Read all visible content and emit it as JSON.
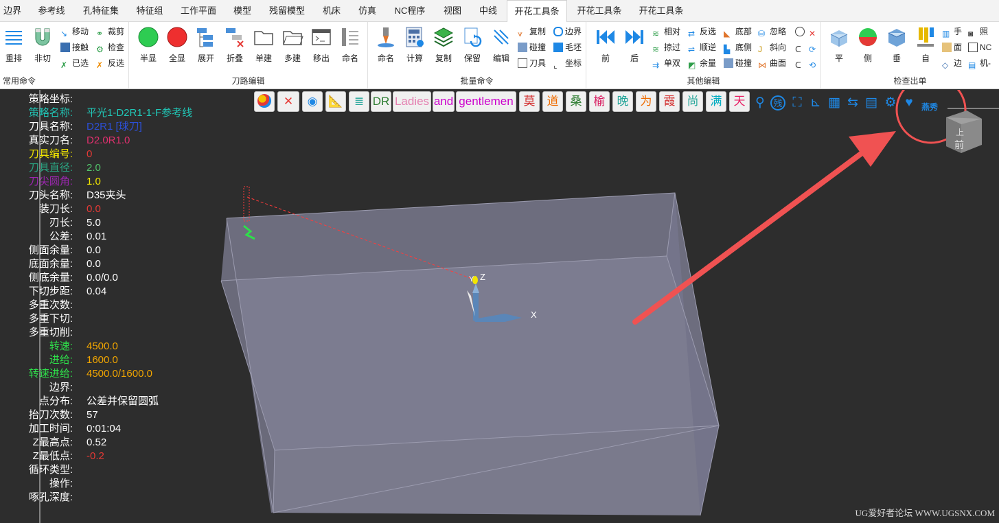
{
  "tabs": [
    {
      "label": "边界"
    },
    {
      "label": "参考线"
    },
    {
      "label": "孔特征集"
    },
    {
      "label": "特征组"
    },
    {
      "label": "工作平面"
    },
    {
      "label": "模型"
    },
    {
      "label": "残留模型"
    },
    {
      "label": "机床"
    },
    {
      "label": "仿真"
    },
    {
      "label": "NC程序"
    },
    {
      "label": "视图"
    },
    {
      "label": "中线"
    },
    {
      "label": "开花工具条"
    },
    {
      "label": "开花工具条"
    },
    {
      "label": "开花工具条"
    }
  ],
  "active_tab_index": 12,
  "groups": {
    "common": {
      "label": "常用命令",
      "big": [
        "重排",
        "非切"
      ],
      "small": [
        "移动",
        "接触",
        "已选",
        "裁剪",
        "检查",
        "反选"
      ]
    },
    "path_edit": {
      "label": "刀路编辑",
      "big": [
        "半显",
        "全显",
        "展开",
        "折叠",
        "单建",
        "多建",
        "移出",
        "命名"
      ]
    },
    "batch": {
      "label": "批量命令",
      "big": [
        "命名",
        "计算",
        "复制",
        "保留",
        "编辑"
      ],
      "small": [
        "复制",
        "碰撞",
        "刀具",
        "边界",
        "毛坯",
        "坐标"
      ]
    },
    "other_edit": {
      "label": "其他编辑",
      "big": [
        "前",
        "后"
      ],
      "small": [
        "相对",
        "掠过",
        "单双",
        "反选",
        "顺逆",
        "余量",
        "底部",
        "底侧",
        "碰撞",
        "忽略",
        "斜向",
        "曲面"
      ]
    },
    "check": {
      "label": "检查出单",
      "big": [
        "平",
        "侧",
        "垂",
        "自"
      ],
      "small": [
        "手",
        "面",
        "边",
        "照",
        "NC",
        "机-"
      ]
    }
  },
  "float_toolbar": {
    "text_buttons": [
      {
        "label": "DR",
        "color": "#2e7d32"
      },
      {
        "label": "Ladies",
        "color": "#e57fb0"
      },
      {
        "label": "and",
        "color": "#cc00cc"
      },
      {
        "label": "gentlemen",
        "color": "#cc00cc"
      },
      {
        "label": "莫",
        "color": "#d32f2f"
      },
      {
        "label": "道",
        "color": "#ef6c00"
      },
      {
        "label": "桑",
        "color": "#2e7d32"
      },
      {
        "label": "榆",
        "color": "#d81b60"
      },
      {
        "label": "晚",
        "color": "#26a69a"
      },
      {
        "label": "为",
        "color": "#ef6c00"
      },
      {
        "label": "霞",
        "color": "#d32f2f"
      },
      {
        "label": "尚",
        "color": "#26a69a"
      },
      {
        "label": "满",
        "color": "#00acc1"
      },
      {
        "label": "天",
        "color": "#e91e63"
      }
    ],
    "end_label": "燕秀",
    "residual_label": "残"
  },
  "info": [
    {
      "label": "策略坐标:",
      "value": "",
      "lc": "#ffffff",
      "vc": "#ffffff"
    },
    {
      "label": "策略名称:",
      "value": "平光1-D2R1-1-F参考线",
      "lc": "#21c6b6",
      "vc": "#21c6b6"
    },
    {
      "label": "刀具名称:",
      "value": "D2R1 [球刀]",
      "lc": "#ffffff",
      "vc": "#2c4fd6"
    },
    {
      "label": "真实刀名:",
      "value": "D2.0R1.0",
      "lc": "#ffffff",
      "vc": "#e0306e"
    },
    {
      "label": "刀具编号:",
      "value": "0",
      "lc": "#f2e600",
      "vc": "#e53935"
    },
    {
      "label": "刀具直径:",
      "value": "2.0",
      "lc": "#2aa784",
      "vc": "#52c36a"
    },
    {
      "label": "刀尖圆角:",
      "value": "1.0",
      "lc": "#9c27b0",
      "vc": "#f2e600"
    },
    {
      "label": "刀头名称:",
      "value": "D35夹头",
      "lc": "#ffffff",
      "vc": "#ffffff"
    },
    {
      "label": "装刀长:",
      "value": "0.0",
      "lc": "#ffffff",
      "vc": "#e53935"
    },
    {
      "label": "刃长:",
      "value": "5.0",
      "lc": "#ffffff",
      "vc": "#ffffff"
    },
    {
      "label": "公差:",
      "value": "0.01",
      "lc": "#ffffff",
      "vc": "#ffffff"
    },
    {
      "label": "侧面余量:",
      "value": "0.0",
      "lc": "#ffffff",
      "vc": "#ffffff"
    },
    {
      "label": "底面余量:",
      "value": "0.0",
      "lc": "#ffffff",
      "vc": "#ffffff"
    },
    {
      "label": "侧底余量:",
      "value": "0.0/0.0",
      "lc": "#ffffff",
      "vc": "#ffffff"
    },
    {
      "label": "下切步距:",
      "value": "0.04",
      "lc": "#ffffff",
      "vc": "#ffffff"
    },
    {
      "label": "多重次数:",
      "value": "",
      "lc": "#ffffff",
      "vc": "#ffffff"
    },
    {
      "label": "多重下切:",
      "value": "",
      "lc": "#ffffff",
      "vc": "#ffffff"
    },
    {
      "label": "多重切削:",
      "value": "",
      "lc": "#ffffff",
      "vc": "#ffffff"
    },
    {
      "label": "转速:",
      "value": "4500.0",
      "lc": "#2ee04a",
      "vc": "#f2a600"
    },
    {
      "label": "进给:",
      "value": "1600.0",
      "lc": "#2ee04a",
      "vc": "#f2a600"
    },
    {
      "label": "转速进给:",
      "value": "4500.0/1600.0",
      "lc": "#2ee04a",
      "vc": "#f2a600"
    },
    {
      "label": "边界:",
      "value": "",
      "lc": "#ffffff",
      "vc": "#ffffff"
    },
    {
      "label": "点分布:",
      "value": "公差并保留圆弧",
      "lc": "#ffffff",
      "vc": "#ffffff"
    },
    {
      "label": "抬刀次数:",
      "value": "57",
      "lc": "#ffffff",
      "vc": "#ffffff"
    },
    {
      "label": "加工时间:",
      "value": "0:01:04",
      "lc": "#ffffff",
      "vc": "#ffffff"
    },
    {
      "label": "Z最高点:",
      "value": "0.52",
      "lc": "#ffffff",
      "vc": "#ffffff"
    },
    {
      "label": "Z最低点:",
      "value": "-0.2",
      "lc": "#ffffff",
      "vc": "#e53935"
    },
    {
      "label": "循环类型:",
      "value": "",
      "lc": "#ffffff",
      "vc": "#ffffff"
    },
    {
      "label": "操作:",
      "value": "",
      "lc": "#ffffff",
      "vc": "#ffffff"
    },
    {
      "label": "啄孔深度:",
      "value": "",
      "lc": "#ffffff",
      "vc": "#ffffff"
    }
  ],
  "axes": {
    "x": "X",
    "z": "Z",
    "y": "Y"
  },
  "view_cube": {
    "top": "上",
    "front": "前"
  },
  "watermark": "UG爱好者论坛 WWW.UGSNX.COM",
  "colors": {
    "accent": "#1e88e5",
    "arrow": "#f05252",
    "tool": "#2ee04a"
  }
}
